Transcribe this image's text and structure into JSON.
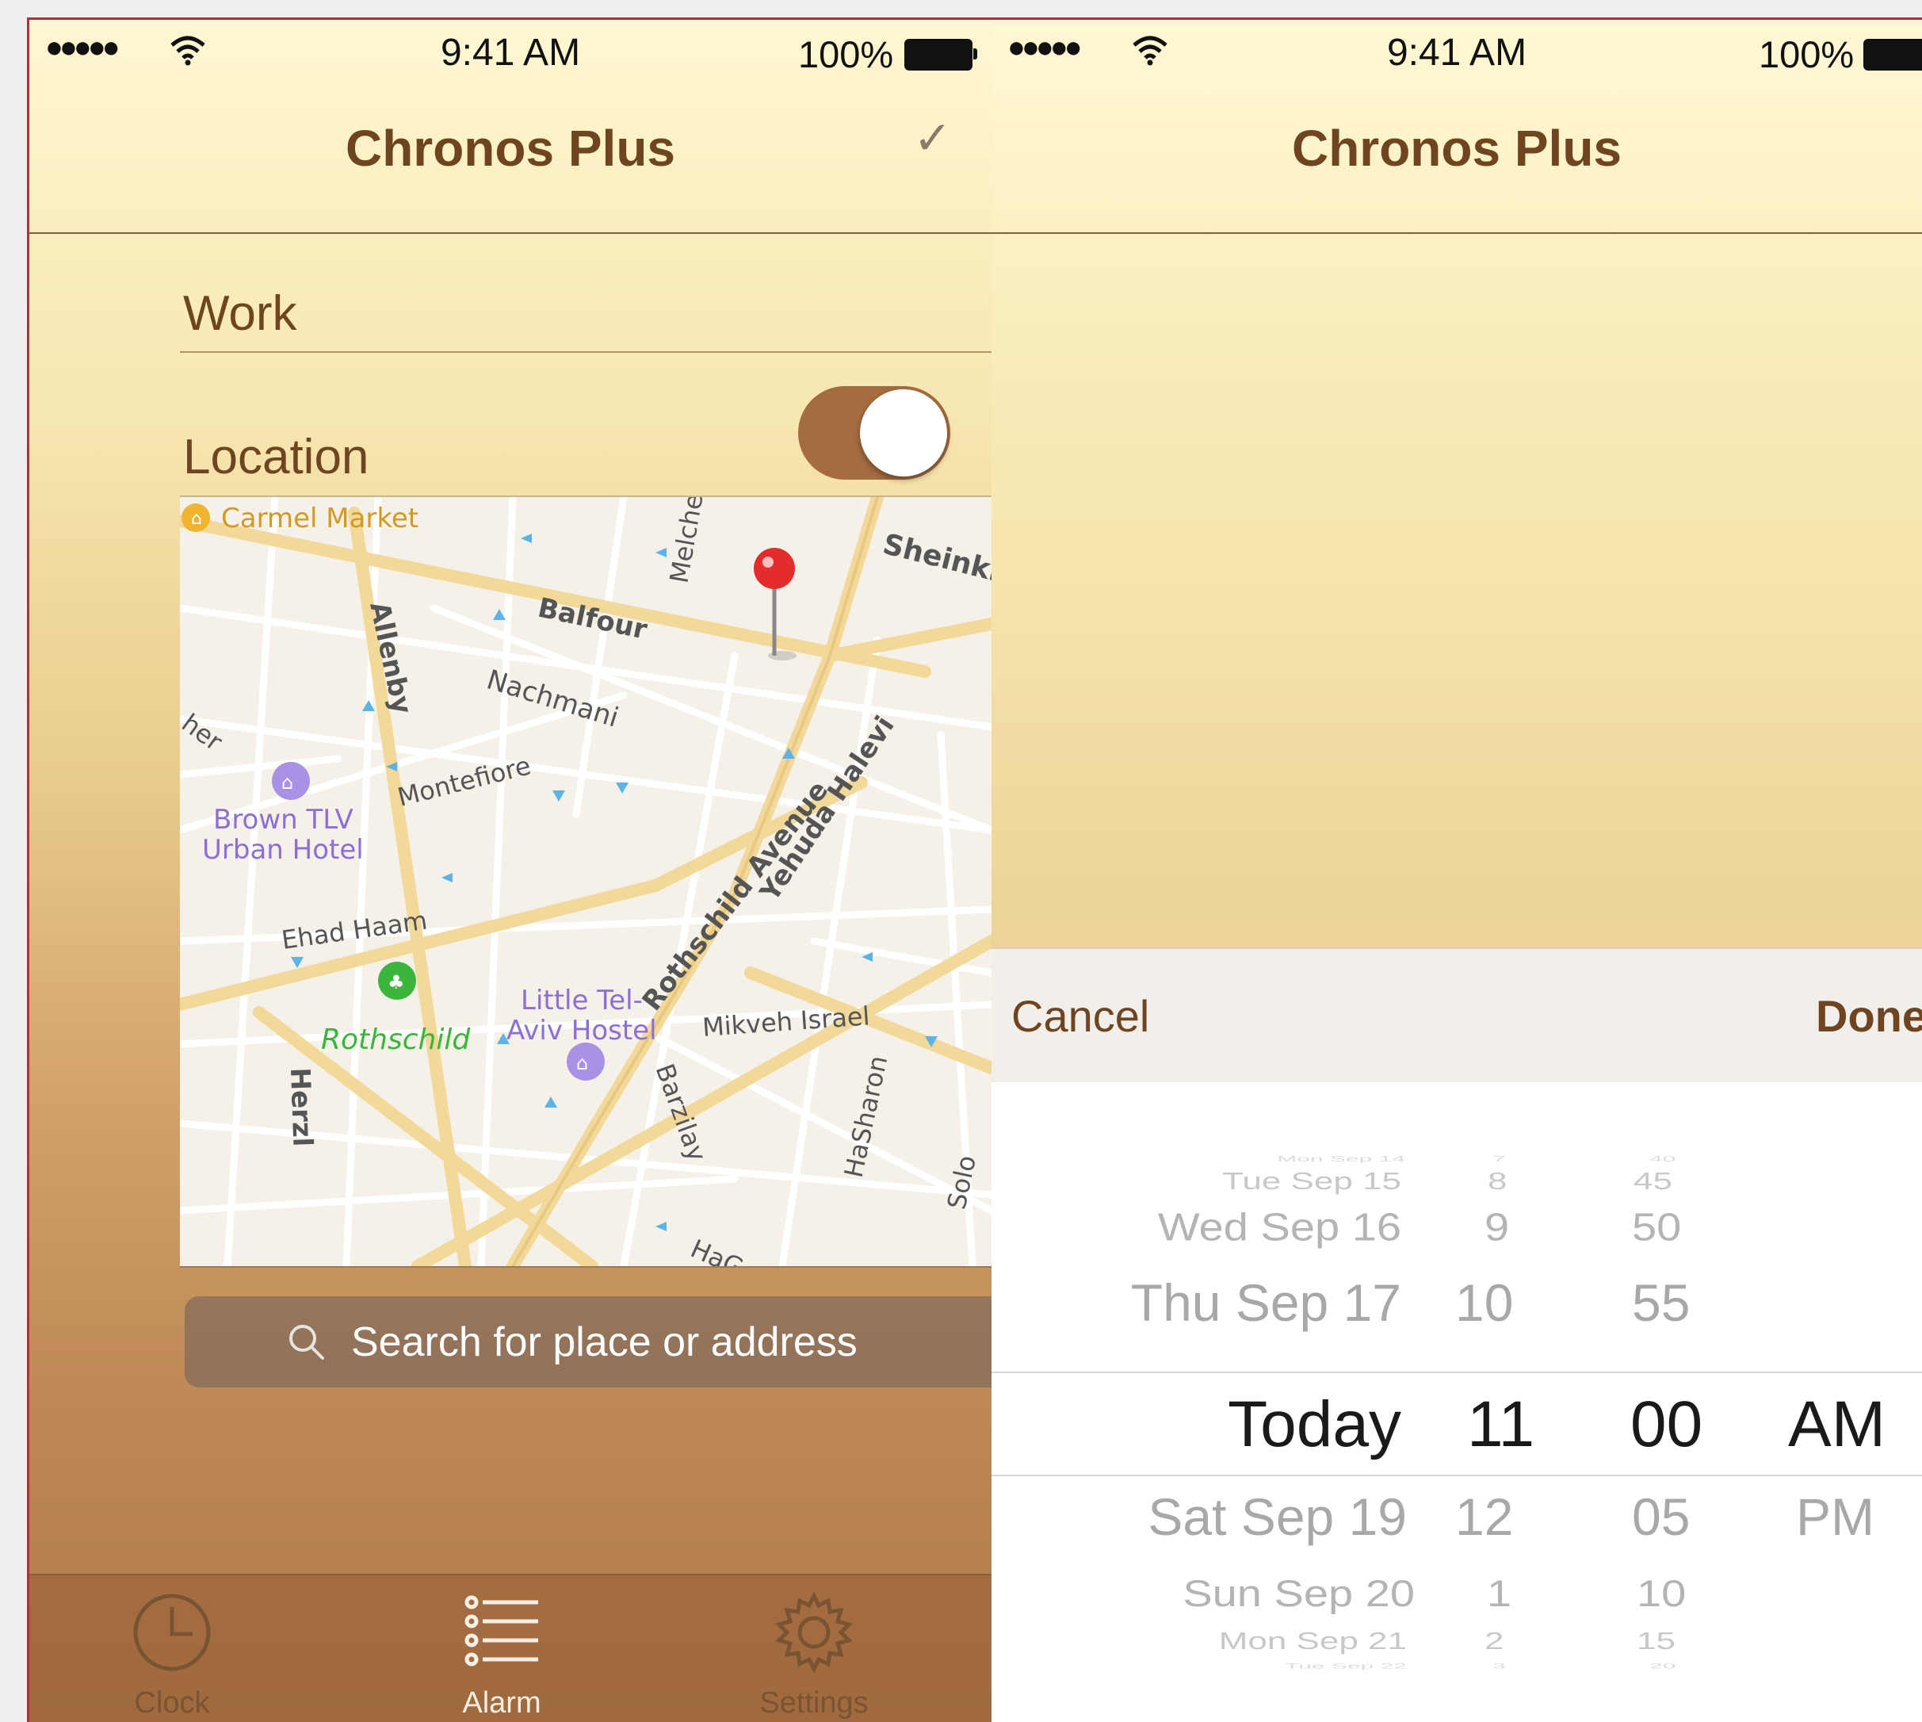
{
  "status": {
    "signal": "●●●●●",
    "time": "9:41 AM",
    "battery": "100%"
  },
  "left": {
    "nav_title": "Chronos Plus",
    "check_icon": "checkmark-icon",
    "name_field": "Work",
    "location_label": "Location",
    "location_toggle_on": true,
    "map": {
      "streets": [
        "Carmel Market",
        "Balfour",
        "Melchet",
        "Sheinkin",
        "Allenby",
        "Nachmani",
        "Montefiore",
        "Rothschild Avenue",
        "Yehuda Halevi",
        "Ehad Haam",
        "Mikveh Israel",
        "Herzl",
        "Barzilay",
        "HaSharon",
        "Solo",
        "HaG",
        "her"
      ],
      "poi": [
        "Brown TLV",
        "Urban Hotel",
        "Little Tel-",
        "Aviv Hostel",
        "Rothschild"
      ]
    },
    "search_placeholder": "Search for place or address",
    "tabs": [
      {
        "label": "Clock",
        "icon": "clock-icon",
        "active": false
      },
      {
        "label": "Alarm",
        "icon": "list-icon",
        "active": true
      },
      {
        "label": "Settings",
        "icon": "gear-icon",
        "active": false
      }
    ]
  },
  "right": {
    "nav_title": "Chronos Plus",
    "cancel_label": "Cancel",
    "done_label": "Done",
    "picker": {
      "dates": [
        "Mon Sep 14",
        "Tue Sep 15",
        "Wed Sep 16",
        "Thu Sep 17",
        "Today",
        "Sat Sep 19",
        "Sun Sep 20",
        "Mon Sep 21",
        "Tue Sep 22"
      ],
      "hours": [
        "7",
        "8",
        "9",
        "10",
        "11",
        "12",
        "1",
        "2",
        "3"
      ],
      "minutes": [
        "40",
        "45",
        "50",
        "55",
        "00",
        "05",
        "10",
        "15",
        "20"
      ],
      "ampm": [
        "AM",
        "PM"
      ]
    }
  },
  "colors": {
    "accent": "#6e4520",
    "toggle": "#a56c3f",
    "frame": "#b0313a"
  }
}
